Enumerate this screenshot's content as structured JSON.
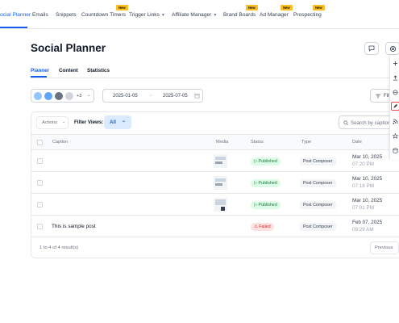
{
  "nav": {
    "items": [
      "ocial Planner",
      "Emails",
      "Snippets",
      "Countdown Timers",
      "Trigger Links",
      "Affiliate Manager",
      "Brand Boards",
      "Ad Manager",
      "Prospecting"
    ],
    "new_badge": "New",
    "accent": "#155eef"
  },
  "page": {
    "title": "Social Planner"
  },
  "subtabs": [
    "Planner",
    "Content",
    "Statistics"
  ],
  "accounts": {
    "more": "+3"
  },
  "date_range": {
    "start": "2025-01-05",
    "end": "2025-07-05",
    "arrow": "→"
  },
  "filters": {
    "label": "Filt"
  },
  "toolbar": {
    "actions": "Actions",
    "filter_views_label": "Filter Views:",
    "filter_views_value": "All",
    "search_placeholder": "Search by caption"
  },
  "table": {
    "columns": [
      "Caption",
      "Media",
      "Status",
      "Type",
      "Date"
    ],
    "rows": [
      {
        "caption": "",
        "status": "Published",
        "type": "Post Composer",
        "date": "Mar 10, 2025",
        "time": "07:20 PM"
      },
      {
        "caption": "",
        "status": "Published",
        "type": "Post Composer",
        "date": "Mar 10, 2025",
        "time": "07:18 PM"
      },
      {
        "caption": "",
        "status": "Published",
        "type": "Post Composer",
        "date": "Mar 10, 2025",
        "time": "07:01 PM"
      },
      {
        "caption": "This is sample post",
        "status": "Failed",
        "type": "Post Composer",
        "date": "Feb 07, 2025",
        "time": "09:29 AM"
      }
    ]
  },
  "pagination": {
    "summary": "1 to 4 of 4 result(s)",
    "previous": "Previous"
  },
  "icons": [
    "chat-icon",
    "settings-icon",
    "plus-icon",
    "upload-icon",
    "globe-icon",
    "pencil-icon",
    "rss-icon",
    "star-icon",
    "database-icon",
    "calendar-icon",
    "filter-icon",
    "search-icon"
  ]
}
